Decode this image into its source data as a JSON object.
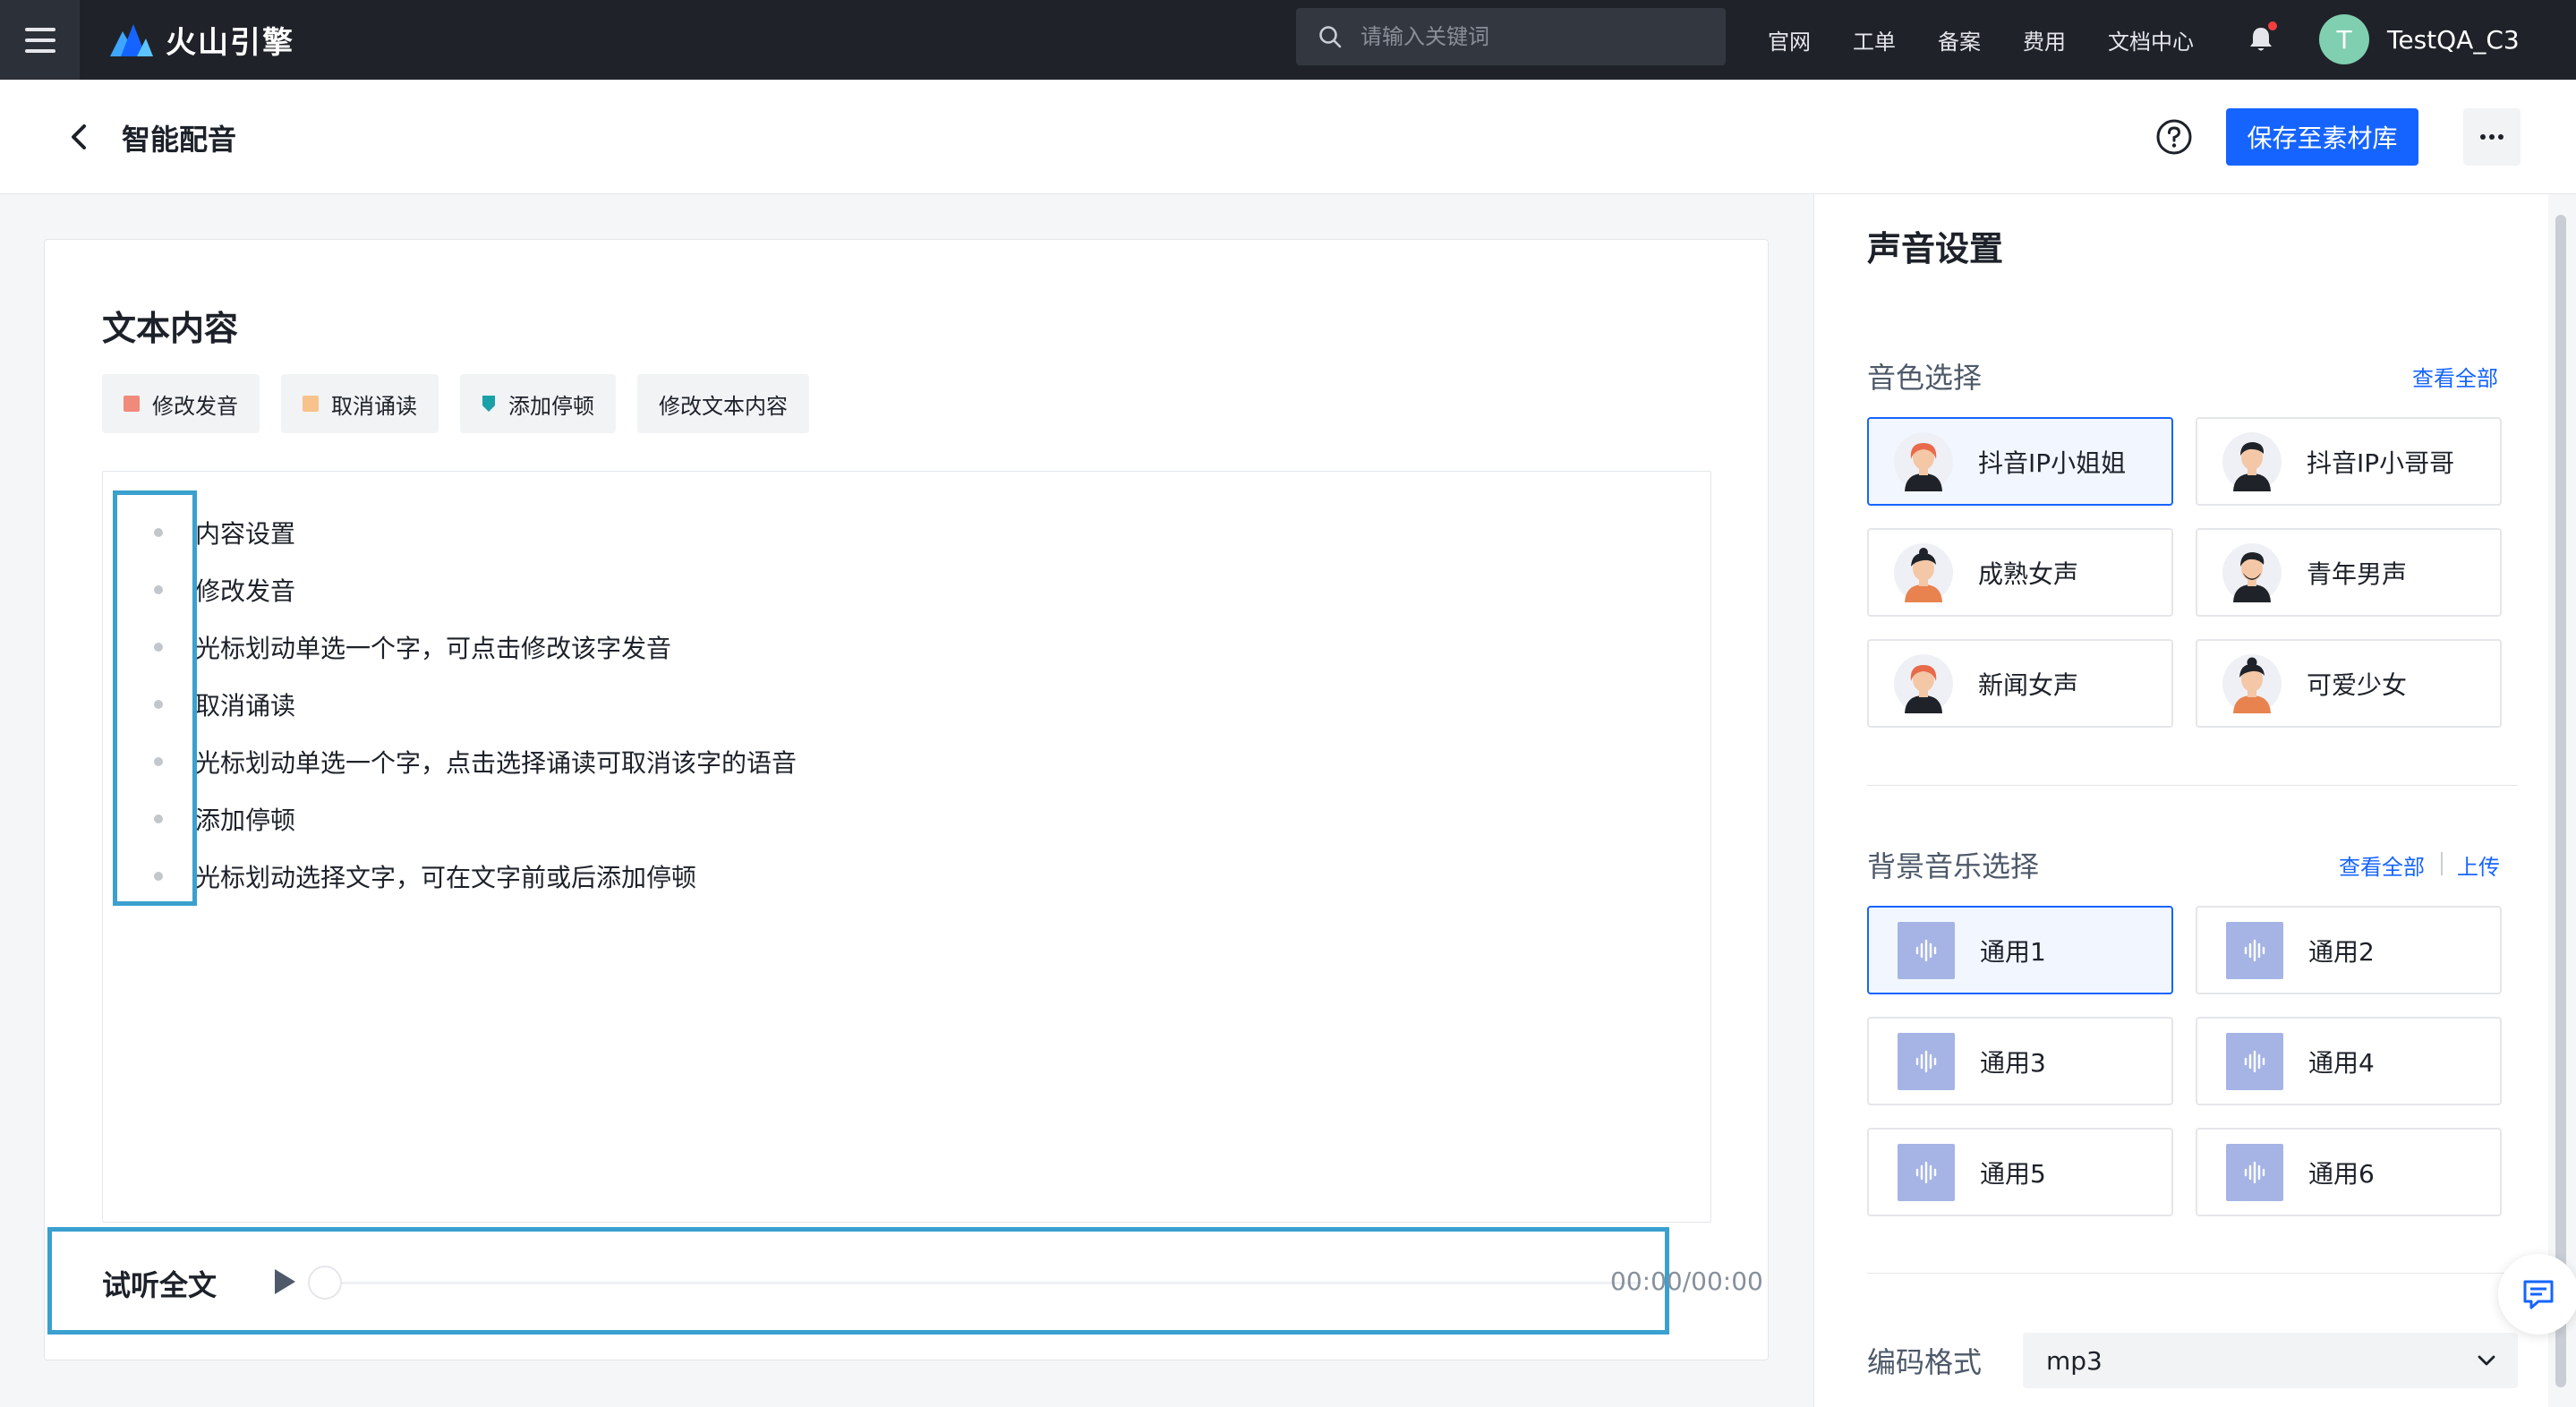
{
  "topbar": {
    "brand": "火山引擎",
    "search_placeholder": "请输入关键词",
    "nav": [
      "官网",
      "工单",
      "备案",
      "费用",
      "文档中心"
    ],
    "user": {
      "initial": "T",
      "name": "TestQA_C3"
    }
  },
  "header": {
    "title": "智能配音",
    "save_label": "保存至素材库"
  },
  "editor": {
    "title": "文本内容",
    "tools": [
      {
        "label": "修改发音",
        "color": "#f08a7b"
      },
      {
        "label": "取消诵读",
        "color": "#f7c28c"
      },
      {
        "label": "添加停顿",
        "color": "#1aa0a8"
      },
      {
        "label": "修改文本内容"
      }
    ],
    "lines": [
      "内容设置",
      "修改发音",
      "光标划动单选一个字，可点击修改该字发音",
      "取消诵读",
      "光标划动单选一个字，点击选择诵读可取消该字的语音",
      "添加停顿",
      "光标划动选择文字，可在文字前或后添加停顿"
    ],
    "player": {
      "label": "试听全文",
      "time": "00:00/00:00"
    }
  },
  "settings": {
    "title": "声音设置",
    "voice": {
      "label": "音色选择",
      "view_all": "查看全部",
      "items": [
        {
          "name": "抖音IP小姐姐",
          "selected": true
        },
        {
          "name": "抖音IP小哥哥",
          "selected": false
        },
        {
          "name": "成熟女声",
          "selected": false
        },
        {
          "name": "青年男声",
          "selected": false
        },
        {
          "name": "新闻女声",
          "selected": false
        },
        {
          "name": "可爱少女",
          "selected": false
        }
      ]
    },
    "music": {
      "label": "背景音乐选择",
      "view_all": "查看全部",
      "upload": "上传",
      "items": [
        {
          "name": "通用1",
          "selected": true
        },
        {
          "name": "通用2",
          "selected": false
        },
        {
          "name": "通用3",
          "selected": false
        },
        {
          "name": "通用4",
          "selected": false
        },
        {
          "name": "通用5",
          "selected": false
        },
        {
          "name": "通用6",
          "selected": false
        }
      ]
    },
    "format": {
      "label": "编码格式",
      "value": "mp3"
    }
  },
  "colors": {
    "accent": "#1664ff",
    "topbar": "#1f2329",
    "highlight": "#3aa0cf"
  }
}
